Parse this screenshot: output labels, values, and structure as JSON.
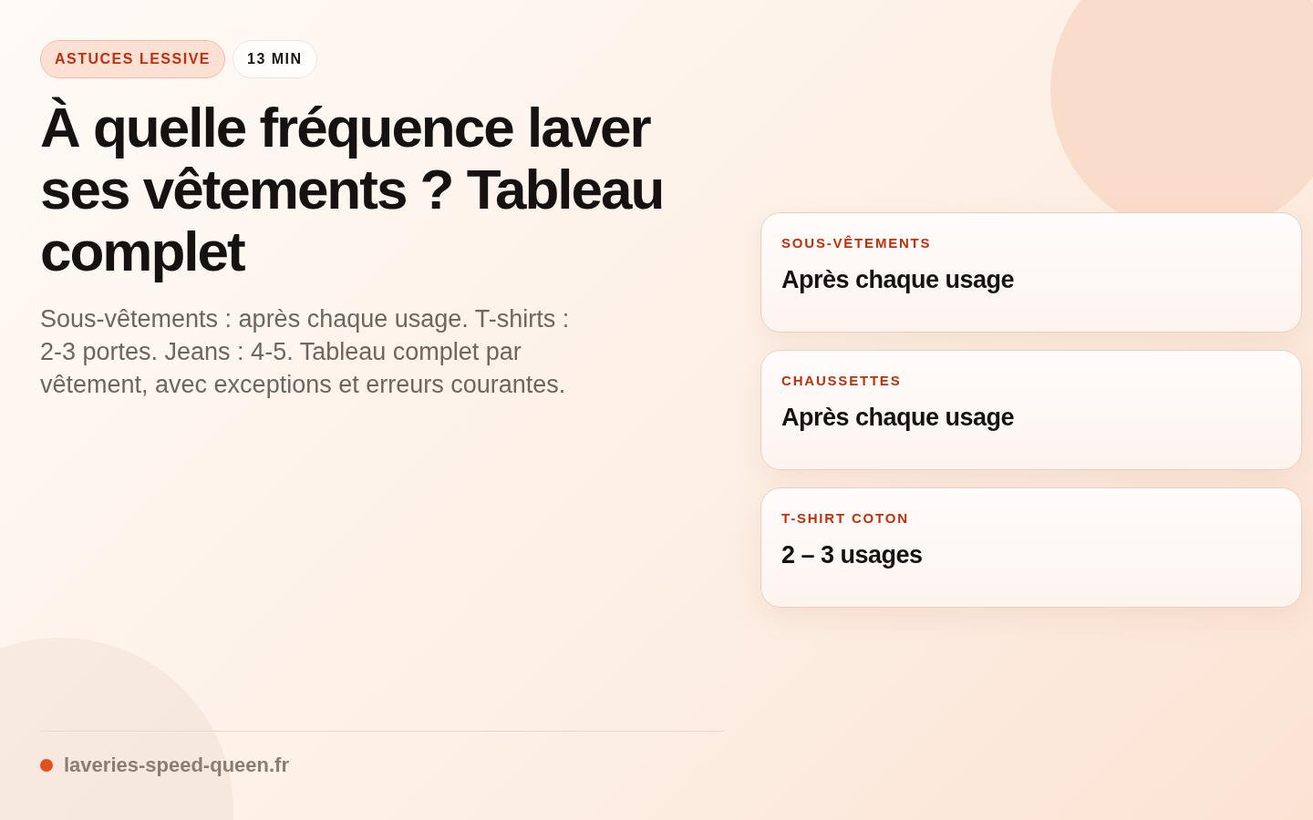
{
  "tags": [
    {
      "kind": "category",
      "label": "ASTUCES LESSIVE"
    },
    {
      "kind": "duration",
      "label": "13 MIN"
    }
  ],
  "title": "À quelle fréquence laver ses vêtements ? Tableau complet",
  "description": "Sous-vêtements : après chaque usage. T-shirts : 2-3 portes. Jeans : 4-5. Tableau complet par vêtement, avec exceptions et erreurs courantes.",
  "cards": [
    {
      "label": "SOUS-VÊTEMENTS",
      "value": "Après chaque usage"
    },
    {
      "label": "CHAUSSETTES",
      "value": "Après chaque usage"
    },
    {
      "label": "T-SHIRT COTON",
      "value": "2 – 3 usages"
    }
  ],
  "footer": {
    "site": "laveries-speed-queen.fr"
  }
}
